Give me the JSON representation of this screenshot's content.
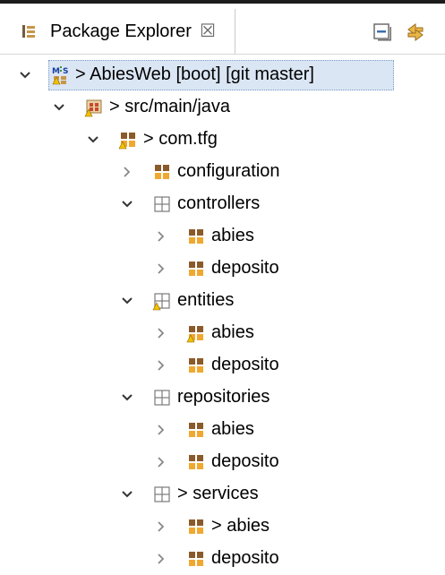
{
  "panel": {
    "tab_label": "Package Explorer",
    "close_glyph": "☒",
    "collapse_all": "collapse-all-icon",
    "link_with_editor": "link-with-editor-icon"
  },
  "colors": {
    "package_brown": "#8b5a2b",
    "package_orange": "#f0a830",
    "selection": "#dbe6f4",
    "warning": "#f3c000"
  },
  "tree": [
    {
      "label": "> AbiesWeb [boot]  [git master]",
      "expanded": true,
      "icon": "maven-spring-project-icon",
      "selected": true
    },
    {
      "label": "> src/main/java",
      "expanded": true,
      "icon": "source-folder-warning-icon"
    },
    {
      "label": "> com.tfg",
      "expanded": true,
      "icon": "package-warning-icon"
    },
    {
      "label": "configuration",
      "expanded": false,
      "icon": "package-icon"
    },
    {
      "label": "controllers",
      "expanded": true,
      "icon": "package-empty-icon"
    },
    {
      "label": "abies",
      "expanded": false,
      "icon": "package-icon"
    },
    {
      "label": "deposito",
      "expanded": false,
      "icon": "package-icon"
    },
    {
      "label": "entities",
      "expanded": true,
      "icon": "package-empty-warning-icon"
    },
    {
      "label": "abies",
      "expanded": false,
      "icon": "package-warning-icon"
    },
    {
      "label": "deposito",
      "expanded": false,
      "icon": "package-icon"
    },
    {
      "label": "repositories",
      "expanded": true,
      "icon": "package-empty-icon"
    },
    {
      "label": "abies",
      "expanded": false,
      "icon": "package-icon"
    },
    {
      "label": "deposito",
      "expanded": false,
      "icon": "package-icon"
    },
    {
      "label": "> services",
      "expanded": true,
      "icon": "package-empty-icon"
    },
    {
      "label": "> abies",
      "expanded": false,
      "icon": "package-icon"
    },
    {
      "label": "deposito",
      "expanded": false,
      "icon": "package-icon"
    }
  ]
}
